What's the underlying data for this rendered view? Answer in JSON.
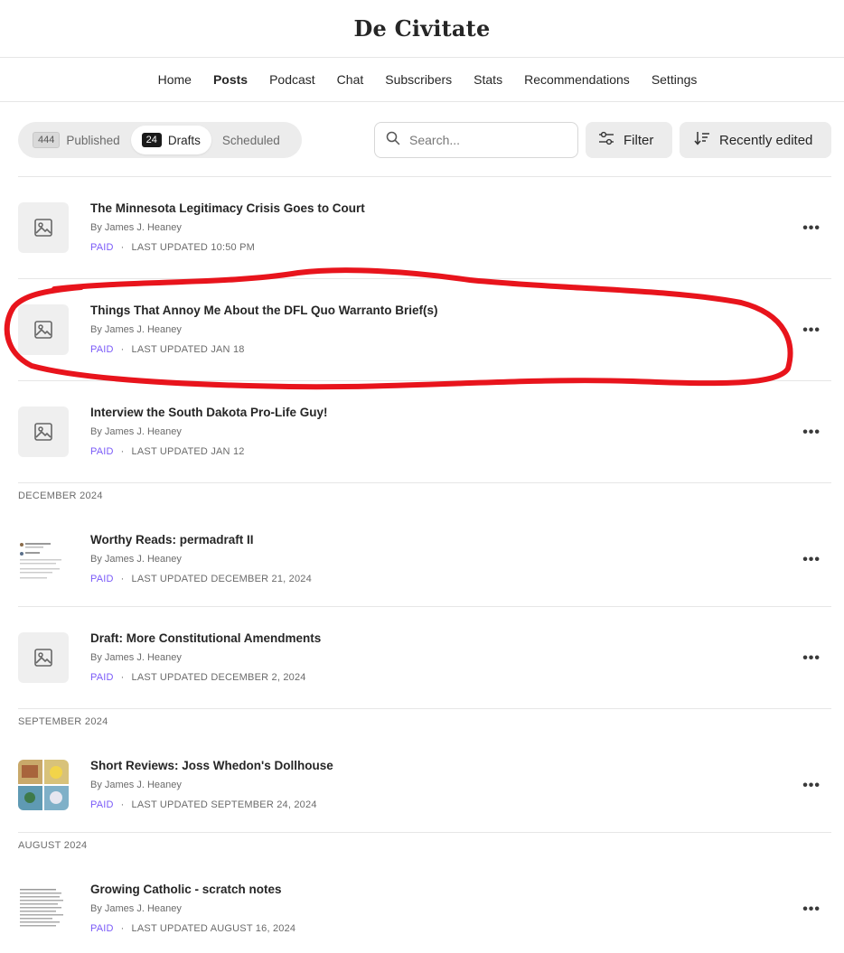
{
  "site": {
    "title": "De Civitate"
  },
  "nav": {
    "items": [
      {
        "label": "Home"
      },
      {
        "label": "Posts"
      },
      {
        "label": "Podcast"
      },
      {
        "label": "Chat"
      },
      {
        "label": "Subscribers"
      },
      {
        "label": "Stats"
      },
      {
        "label": "Recommendations"
      },
      {
        "label": "Settings"
      }
    ],
    "active": "Posts"
  },
  "tabs": {
    "published": {
      "count": "444",
      "label": "Published"
    },
    "drafts": {
      "count": "24",
      "label": "Drafts"
    },
    "scheduled": {
      "label": "Scheduled"
    }
  },
  "search": {
    "placeholder": "Search..."
  },
  "filter": {
    "label": "Filter"
  },
  "sort": {
    "label": "Recently edited"
  },
  "colors": {
    "paid": "#7a5af8",
    "annotation": "#e8141c"
  },
  "posts": [
    {
      "title": "The Minnesota Legitimacy Crisis Goes to Court",
      "author": "By James J. Heaney",
      "tier": "PAID",
      "updated": "LAST UPDATED 10:50 PM"
    },
    {
      "title": "Things That Annoy Me About the DFL Quo Warranto Brief(s)",
      "author": "By James J. Heaney",
      "tier": "PAID",
      "updated": "LAST UPDATED JAN 18"
    },
    {
      "title": "Interview the South Dakota Pro-Life Guy!",
      "author": "By James J. Heaney",
      "tier": "PAID",
      "updated": "LAST UPDATED JAN 12"
    },
    {
      "title": "Worthy Reads: permadraft II",
      "author": "By James J. Heaney",
      "tier": "PAID",
      "updated": "LAST UPDATED DECEMBER 21, 2024"
    },
    {
      "title": "Draft: More Constitutional Amendments",
      "author": "By James J. Heaney",
      "tier": "PAID",
      "updated": "LAST UPDATED DECEMBER 2, 2024"
    },
    {
      "title": "Short Reviews: Joss Whedon's Dollhouse",
      "author": "By James J. Heaney",
      "tier": "PAID",
      "updated": "LAST UPDATED SEPTEMBER 24, 2024"
    },
    {
      "title": "Growing Catholic - scratch notes",
      "author": "By James J. Heaney",
      "tier": "PAID",
      "updated": "LAST UPDATED AUGUST 16, 2024"
    }
  ],
  "sections": {
    "dec2024": "DECEMBER 2024",
    "sep2024": "SEPTEMBER 2024",
    "aug2024": "AUGUST 2024"
  }
}
